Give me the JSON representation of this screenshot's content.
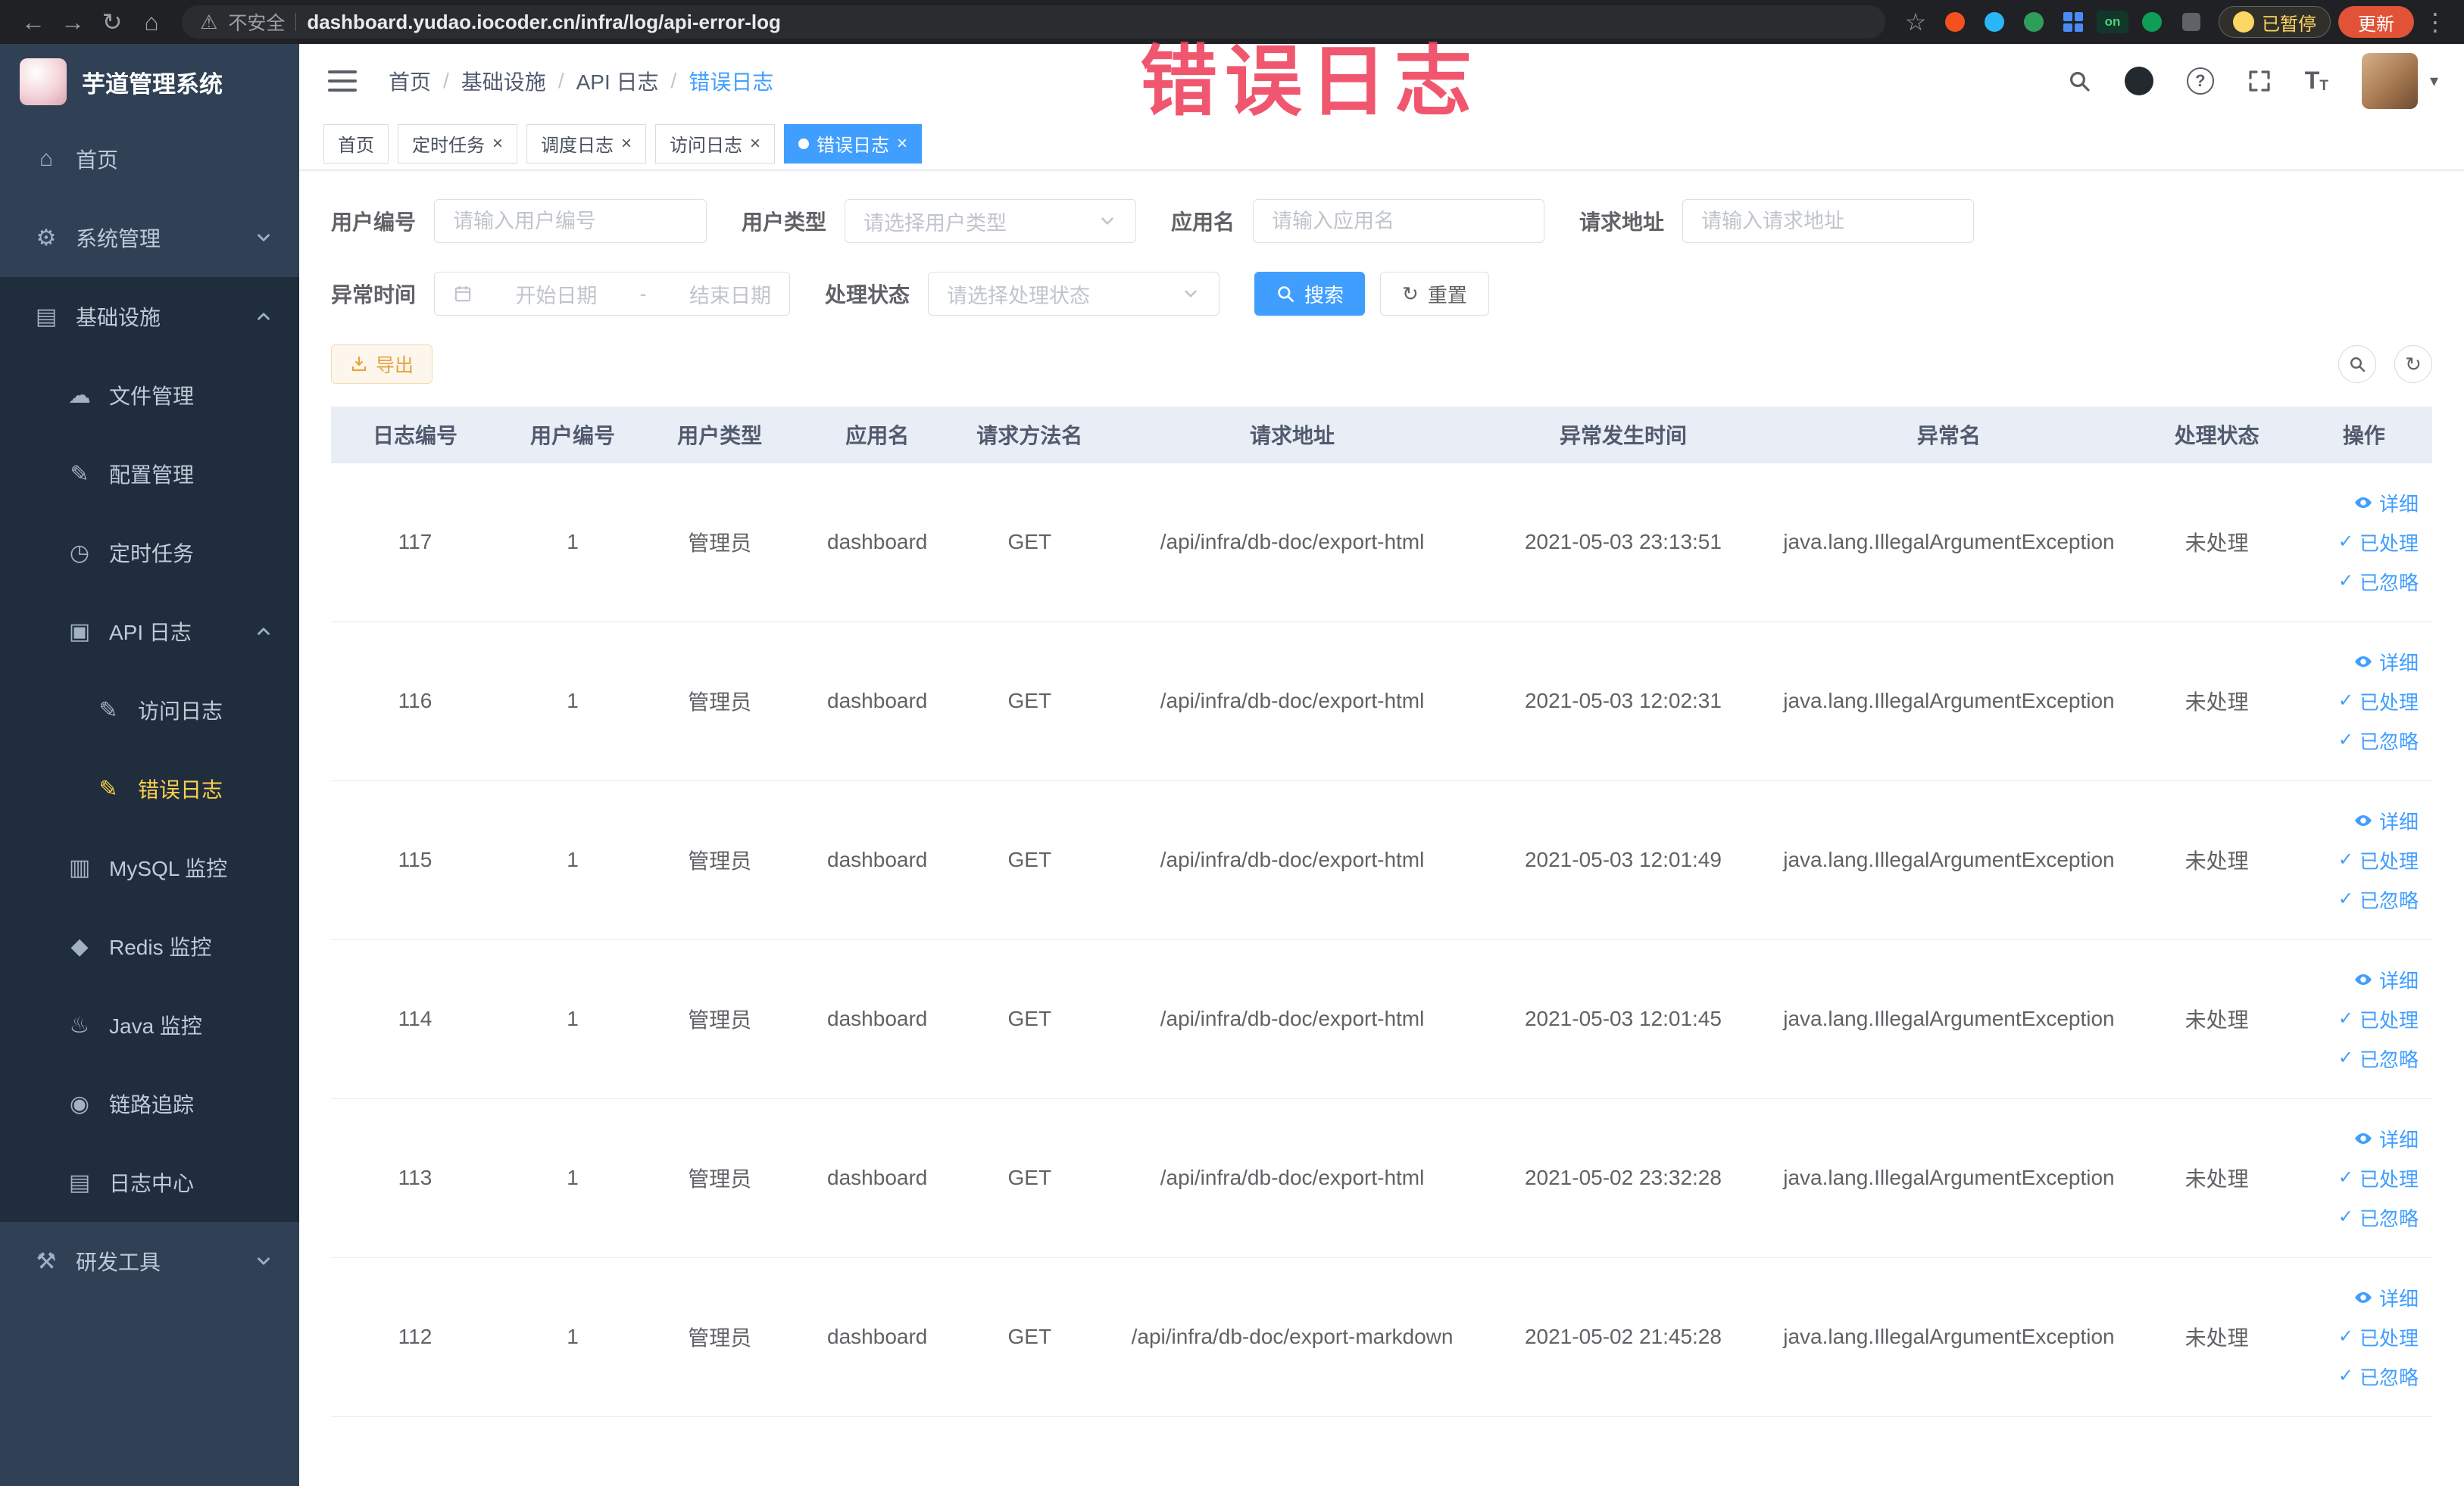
{
  "watermark": "错误日志",
  "browser": {
    "security_label": "不安全",
    "url": "dashboard.yudao.iocoder.cn/infra/log/api-error-log",
    "extension_on_badge": "on",
    "paused_badge": "已暂停",
    "update_button": "更新"
  },
  "sidebar": {
    "logo_title": "芋道管理系统",
    "menu": [
      {
        "label": "首页",
        "icon": "home-icon",
        "depth": 0
      },
      {
        "label": "系统管理",
        "icon": "gear-icon",
        "depth": 0,
        "has_children": true,
        "expanded": false
      },
      {
        "label": "基础设施",
        "icon": "infrastructure-icon",
        "depth": 0,
        "has_children": true,
        "expanded": true
      },
      {
        "label": "文件管理",
        "icon": "file-manage-icon",
        "depth": 1
      },
      {
        "label": "配置管理",
        "icon": "config-manage-icon",
        "depth": 1
      },
      {
        "label": "定时任务",
        "icon": "scheduled-task-icon",
        "depth": 1
      },
      {
        "label": "API 日志",
        "icon": "api-log-icon",
        "depth": 1,
        "has_children": true,
        "expanded": true
      },
      {
        "label": "访问日志",
        "icon": "access-log-icon",
        "depth": 2
      },
      {
        "label": "错误日志",
        "icon": "error-log-icon",
        "depth": 2,
        "active": true
      },
      {
        "label": "MySQL 监控",
        "icon": "mysql-monitor-icon",
        "depth": 1
      },
      {
        "label": "Redis 监控",
        "icon": "redis-monitor-icon",
        "depth": 1
      },
      {
        "label": "Java 监控",
        "icon": "java-monitor-icon",
        "depth": 1
      },
      {
        "label": "链路追踪",
        "icon": "trace-icon",
        "depth": 1
      },
      {
        "label": "日志中心",
        "icon": "log-center-icon",
        "depth": 1
      },
      {
        "label": "研发工具",
        "icon": "dev-tools-icon",
        "depth": 0,
        "has_children": true,
        "expanded": false
      }
    ]
  },
  "header": {
    "breadcrumb": [
      "首页",
      "基础设施",
      "API 日志",
      "错误日志"
    ]
  },
  "tabs": [
    {
      "label": "首页",
      "closable": false,
      "active": false
    },
    {
      "label": "定时任务",
      "closable": true,
      "active": false
    },
    {
      "label": "调度日志",
      "closable": true,
      "active": false
    },
    {
      "label": "访问日志",
      "closable": true,
      "active": false
    },
    {
      "label": "错误日志",
      "closable": true,
      "active": true
    }
  ],
  "filters": {
    "user_id_label": "用户编号",
    "user_id_placeholder": "请输入用户编号",
    "user_type_label": "用户类型",
    "user_type_placeholder": "请选择用户类型",
    "app_name_label": "应用名",
    "app_name_placeholder": "请输入应用名",
    "request_url_label": "请求地址",
    "request_url_placeholder": "请输入请求地址",
    "exception_time_label": "异常时间",
    "start_date_placeholder": "开始日期",
    "date_separator": "-",
    "end_date_placeholder": "结束日期",
    "process_status_label": "处理状态",
    "process_status_placeholder": "请选择处理状态",
    "search_button": "搜索",
    "reset_button": "重置"
  },
  "toolbar": {
    "export_button": "导出"
  },
  "table": {
    "columns": [
      "日志编号",
      "用户编号",
      "用户类型",
      "应用名",
      "请求方法名",
      "请求地址",
      "异常发生时间",
      "异常名",
      "处理状态",
      "操作"
    ],
    "row_actions": [
      "详细",
      "已处理",
      "已忽略"
    ],
    "rows": [
      {
        "log_id": "117",
        "user_id": "1",
        "user_type": "管理员",
        "app_name": "dashboard",
        "method": "GET",
        "request_url": "/api/infra/db-doc/export-html",
        "exception_time": "2021-05-03 23:13:51",
        "exception_name": "java.lang.IllegalArgumentException",
        "status": "未处理"
      },
      {
        "log_id": "116",
        "user_id": "1",
        "user_type": "管理员",
        "app_name": "dashboard",
        "method": "GET",
        "request_url": "/api/infra/db-doc/export-html",
        "exception_time": "2021-05-03 12:02:31",
        "exception_name": "java.lang.IllegalArgumentException",
        "status": "未处理"
      },
      {
        "log_id": "115",
        "user_id": "1",
        "user_type": "管理员",
        "app_name": "dashboard",
        "method": "GET",
        "request_url": "/api/infra/db-doc/export-html",
        "exception_time": "2021-05-03 12:01:49",
        "exception_name": "java.lang.IllegalArgumentException",
        "status": "未处理"
      },
      {
        "log_id": "114",
        "user_id": "1",
        "user_type": "管理员",
        "app_name": "dashboard",
        "method": "GET",
        "request_url": "/api/infra/db-doc/export-html",
        "exception_time": "2021-05-03 12:01:45",
        "exception_name": "java.lang.IllegalArgumentException",
        "status": "未处理"
      },
      {
        "log_id": "113",
        "user_id": "1",
        "user_type": "管理员",
        "app_name": "dashboard",
        "method": "GET",
        "request_url": "/api/infra/db-doc/export-html",
        "exception_time": "2021-05-02 23:32:28",
        "exception_name": "java.lang.IllegalArgumentException",
        "status": "未处理"
      },
      {
        "log_id": "112",
        "user_id": "1",
        "user_type": "管理员",
        "app_name": "dashboard",
        "method": "GET",
        "request_url": "/api/infra/db-doc/export-markdown",
        "exception_time": "2021-05-02 21:45:28",
        "exception_name": "java.lang.IllegalArgumentException",
        "status": "未处理"
      }
    ]
  }
}
